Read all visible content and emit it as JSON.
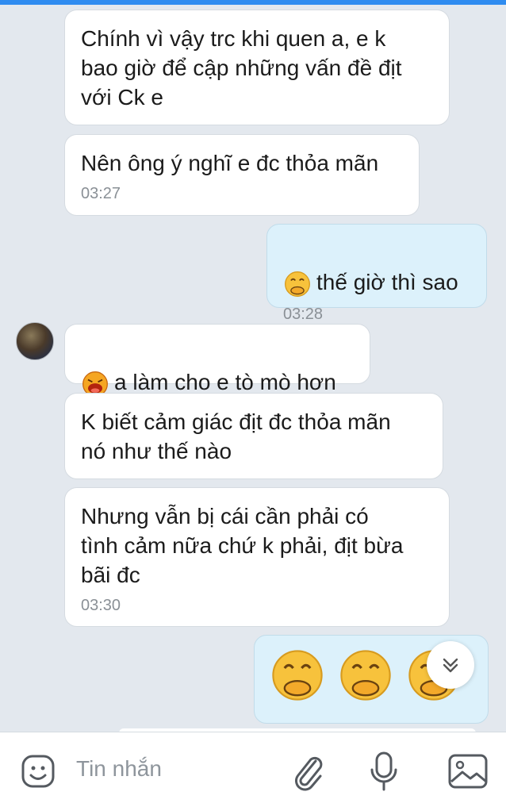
{
  "messages": [
    {
      "side": "in",
      "text": "Chính vì vậy trc khi quen a, e k\nbao giờ để cập những vấn đề địt\nvới Ck e",
      "time": ""
    },
    {
      "side": "in",
      "text": "Nên ông ý nghĩ e đc thỏa mãn",
      "time": "03:27"
    },
    {
      "side": "out",
      "emoji": "thinking-face",
      "text": "thế giờ thì sao",
      "time": "03:28"
    },
    {
      "side": "in",
      "emoji": "laughing-face",
      "text": "a làm cho e tò mò hơn",
      "time": ""
    },
    {
      "side": "in",
      "text": "K biết cảm giác địt đc thỏa mãn\nnó như thế nào",
      "time": ""
    },
    {
      "side": "in",
      "text": "Nhưng vẫn bị cái cần phải có\ntình cảm nữa chứ k phải, địt bừa\nbãi đc",
      "time": "03:30"
    },
    {
      "side": "out",
      "emoji": [
        "thinking-face",
        "thinking-face",
        "thinking-face"
      ],
      "text": "",
      "time": ""
    }
  ],
  "input": {
    "placeholder": "Tin nhắn",
    "icons": [
      "sticker-icon",
      "attach-icon",
      "microphone-icon",
      "image-icon"
    ]
  },
  "scroll_button": {
    "icon": "double-chevron-down-icon"
  },
  "colors": {
    "incoming_bubble": "#ffffff",
    "outgoing_bubble": "#dcf1fb",
    "background": "#e3e8ee",
    "timestamp": "#8a9096"
  }
}
